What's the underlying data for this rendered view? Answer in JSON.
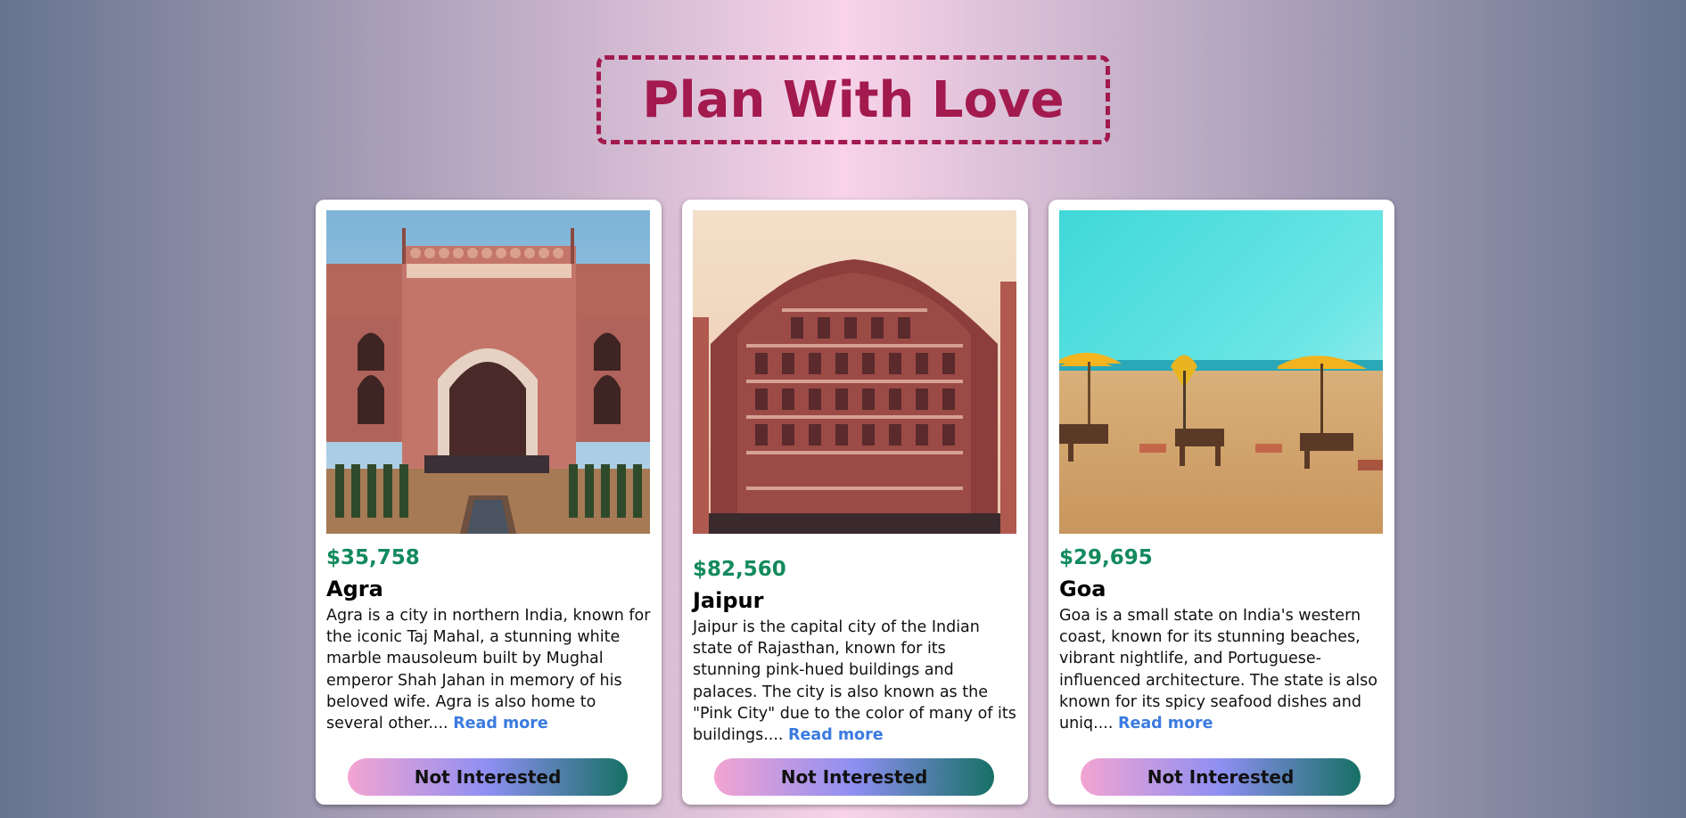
{
  "header": {
    "title": "Plan With Love"
  },
  "tours": [
    {
      "price": "$35,758",
      "city": "Agra",
      "description": "Agra is a city in northern India, known for the iconic Taj Mahal, a stunning white marble mausoleum built by Mughal emperor Shah Jahan in memory of his beloved wife. Agra is also home to several other....",
      "read_more": "Read more",
      "button": "Not Interested"
    },
    {
      "price": "$82,560",
      "city": "Jaipur",
      "description": "Jaipur is the capital city of the Indian state of Rajasthan, known for its stunning pink-hued buildings and palaces. The city is also known as the \"Pink City\" due to the color of many of its buildings....",
      "read_more": "Read more",
      "button": "Not Interested"
    },
    {
      "price": "$29,695",
      "city": "Goa",
      "description": "Goa is a small state on India's western coast, known for its stunning beaches, vibrant nightlife, and Portuguese-influenced architecture. The state is also known for its spicy seafood dishes and uniq....",
      "read_more": "Read more",
      "button": "Not Interested"
    }
  ],
  "colors": {
    "title": "#a31a4e",
    "price": "#138a5e",
    "read_more": "#3b7be0"
  }
}
